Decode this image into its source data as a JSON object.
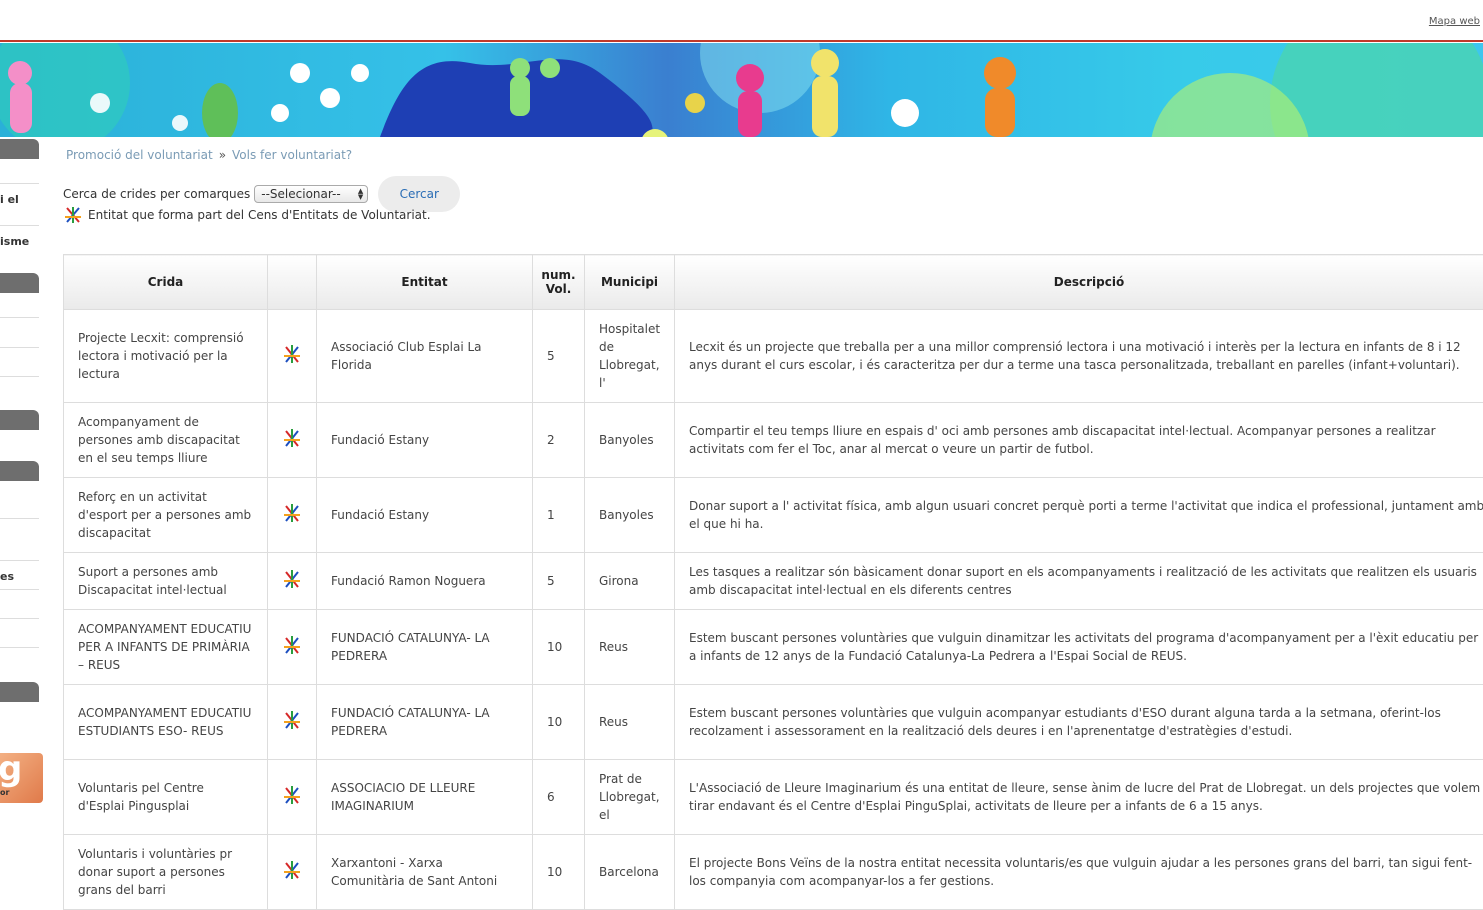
{
  "header": {
    "sitemap_link": "Mapa web"
  },
  "sidebar": {
    "fragments": [
      "i el",
      "isme",
      "es"
    ],
    "badge": {
      "letter": "g",
      "text": "or"
    }
  },
  "breadcrumb": {
    "item1": "Promoció del voluntariat",
    "separator": "»",
    "item2": "Vols fer voluntariat?"
  },
  "search": {
    "label": "Cerca de crides per comarques",
    "select_value": "--Selecionar--",
    "button": "Cercar"
  },
  "legend": {
    "icon": "cens-entitats-icon",
    "text": "Entitat que forma part del Cens d'Entitats de Voluntariat."
  },
  "table": {
    "headers": {
      "crida": "Crida",
      "icon": "",
      "entitat": "Entitat",
      "num_vol": "num. Vol.",
      "municipi": "Municipi",
      "descripcio": "Descripció"
    },
    "rows": [
      {
        "crida": "Projecte Lecxit: comprensió lectora i motivació per la lectura",
        "entitat": "Associació Club Esplai La Florida",
        "num": "5",
        "municipi": "Hospitalet de Llobregat, l'",
        "descripcio": "Lecxit és un projecte que treballa per a una millor comprensió lectora i una motivació i interès per la lectura en infants de 8 i 12 anys durant el curs escolar, i és caracteritza per dur a terme una tasca personalitzada, treballant en parelles (infant+voluntari)."
      },
      {
        "crida": "Acompanyament de persones amb discapacitat en el seu temps lliure",
        "entitat": "Fundació Estany",
        "num": "2",
        "municipi": "Banyoles",
        "descripcio": "Compartir el teu temps lliure en espais d' oci amb persones amb discapacitat intel·lectual. Acompanyar persones a realitzar activitats com fer el Toc, anar al mercat o veure un partir de futbol."
      },
      {
        "crida": "Reforç en un activitat d'esport per a persones amb discapacitat",
        "entitat": "Fundació Estany",
        "num": "1",
        "municipi": "Banyoles",
        "descripcio": "Donar suport a l' activitat física, amb algun usuari concret perquè porti a terme l'activitat que indica el professional, juntament amb el que hi ha."
      },
      {
        "crida": "Suport a persones amb Discapacitat intel·lectual",
        "entitat": "Fundació Ramon Noguera",
        "num": "5",
        "municipi": "Girona",
        "descripcio": "Les tasques a realitzar són bàsicament donar suport en els acompanyaments i realització de les activitats que realitzen els usuaris amb discapacitat intel·lectual en els diferents centres"
      },
      {
        "crida": "ACOMPANYAMENT EDUCATIU PER A INFANTS DE PRIMÀRIA – REUS",
        "entitat": "FUNDACIÓ CATALUNYA- LA PEDRERA",
        "num": "10",
        "municipi": "Reus",
        "descripcio": "Estem buscant persones voluntàries que vulguin dinamitzar les activitats del programa d'acompanyament per a l'èxit educatiu per a infants de 12 anys de la Fundació Catalunya-La Pedrera a l'Espai Social de REUS."
      },
      {
        "crida": "ACOMPANYAMENT EDUCATIU ESTUDIANTS ESO- REUS",
        "entitat": "FUNDACIÓ CATALUNYA- LA PEDRERA",
        "num": "10",
        "municipi": "Reus",
        "descripcio": "Estem buscant persones voluntàries que vulguin acompanyar estudiants d'ESO durant alguna tarda a la setmana, oferint-los recolzament i assessorament en la realització dels deures i en l'aprenentatge d'estratègies d'estudi."
      },
      {
        "crida": "Voluntaris pel Centre d'Esplai Pingusplai",
        "entitat": "ASSOCIACIO DE LLEURE IMAGINARIUM",
        "num": "6",
        "municipi": "Prat de Llobregat, el",
        "descripcio": "L'Associació de Lleure Imaginarium és una entitat de lleure, sense ànim de lucre del Prat de Llobregat. un dels projectes que volem tirar endavant és el Centre d'Esplai PinguSplai, activitats de lleure per a infants de 6 a 15 anys."
      },
      {
        "crida": "Voluntaris i voluntàries pr donar suport a persones grans del barri",
        "entitat": "Xarxantoni - Xarxa Comunitària de Sant Antoni",
        "num": "10",
        "municipi": "Barcelona",
        "descripcio": "El projecte Bons Veïns de la nostra entitat necessita voluntaris/es que vulguin ajudar a les persones grans del barri, tan sigui fent-los companyia com acompanyar-los a fer gestions."
      }
    ]
  }
}
